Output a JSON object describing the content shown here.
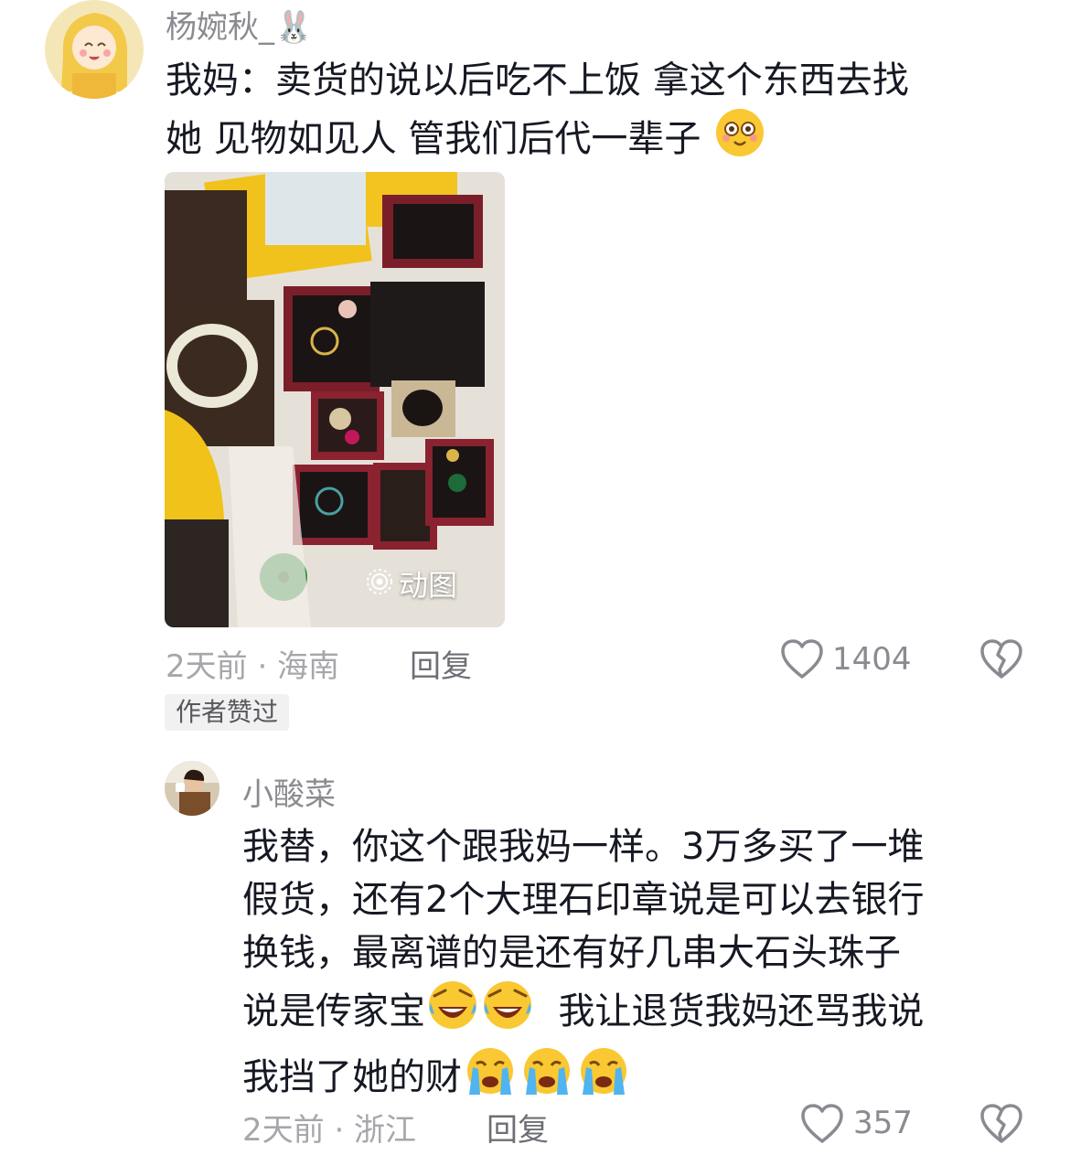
{
  "comments": [
    {
      "username": "杨婉秋_🐰",
      "text_line1": "我妈：卖货的说以后吃不上饭 拿这个东西去找",
      "text_line2": "她 见物如见人 管我们后代一辈子",
      "time_location": "2天前 · 海南",
      "reply_label": "回复",
      "likes": "1404",
      "author_liked_label": "作者赞过",
      "image_badge": "动图"
    },
    {
      "username": "小酸菜",
      "lines": [
        "我替，你这个跟我妈一样。3万多买了一堆",
        "假货，还有2个大理石印章说是可以去银行",
        "换钱，最离谱的是还有好几串大石头珠子",
        "说是传家宝",
        "我让退货我妈还骂我说",
        "我挡了她的财"
      ],
      "time_location": "2天前 · 浙江",
      "reply_label": "回复",
      "likes": "357"
    }
  ],
  "icons": {
    "like": "heart-outline-icon",
    "dislike": "broken-heart-icon",
    "gif": "animated-gif-icon"
  },
  "colors": {
    "text_primary": "#161823",
    "text_secondary": "#8a8b91",
    "emoji_yellow": "#f9c832"
  }
}
